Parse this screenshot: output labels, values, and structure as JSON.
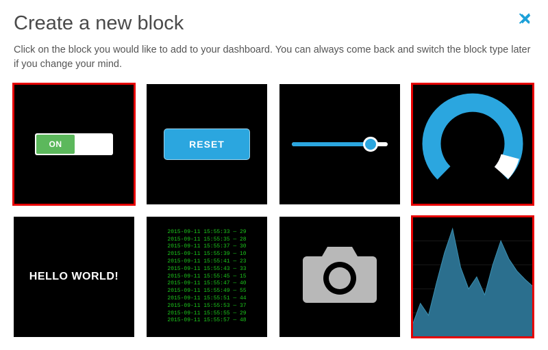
{
  "modal": {
    "title": "Create a new block",
    "subtitle": "Click on the block you would like to add to your dashboard. You can always come back and switch the block type later if you change your mind."
  },
  "blocks": {
    "toggle": {
      "label": "ON"
    },
    "button": {
      "label": "RESET"
    },
    "slider": {
      "value_pct": 78
    },
    "gauge": {
      "value_pct": 85
    },
    "text": {
      "content": "HELLO WORLD!"
    },
    "stream": {
      "lines": [
        "2015-09-11 15:55:33 — 29",
        "2015-09-11 15:55:35 — 28",
        "2015-09-11 15:55:37 — 30",
        "2015-09-11 15:55:39 — 10",
        "2015-09-11 15:55:41 — 23",
        "2015-09-11 15:55:43 — 33",
        "2015-09-11 15:55:45 — 15",
        "2015-09-11 15:55:47 — 40",
        "2015-09-11 15:55:49 — 55",
        "2015-09-11 15:55:51 — 44",
        "2015-09-11 15:55:53 — 37",
        "2015-09-11 15:55:55 — 29",
        "2015-09-11 15:55:57 — 48"
      ]
    }
  },
  "chart_data": {
    "type": "area",
    "title": "",
    "xlabel": "",
    "ylabel": "",
    "x": [
      0,
      1,
      2,
      3,
      4,
      5,
      6,
      7,
      8,
      9,
      10,
      11,
      12,
      13,
      14,
      15
    ],
    "values": [
      10,
      28,
      18,
      45,
      70,
      90,
      58,
      40,
      50,
      35,
      60,
      80,
      65,
      55,
      48,
      42
    ],
    "ylim": [
      0,
      100
    ],
    "color": "#2b6f8e"
  },
  "colors": {
    "accent": "#2ba6df",
    "success": "#5cb85c",
    "highlight": "#e60000",
    "chart_fill": "#2b6f8e"
  }
}
